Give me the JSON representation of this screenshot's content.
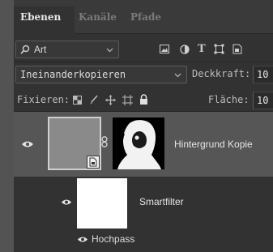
{
  "tabs": [
    {
      "label": "Ebenen",
      "active": true
    },
    {
      "label": "Kanäle",
      "active": false
    },
    {
      "label": "Pfade",
      "active": false
    }
  ],
  "filter": {
    "kind_label": "Art",
    "icons": [
      "image-filter-icon",
      "adjustment-filter-icon",
      "type-filter-icon",
      "shape-filter-icon",
      "smartobject-filter-icon"
    ]
  },
  "blend": {
    "mode": "Ineinanderkopieren",
    "opacity_label": "Deckkraft:",
    "opacity_value": "10"
  },
  "lock": {
    "label": "Fixieren:",
    "fill_label": "Fläche:",
    "fill_value": "10",
    "icons": [
      "lock-transparent-icon",
      "lock-paint-icon",
      "lock-position-icon",
      "lock-artboard-icon",
      "lock-all-icon"
    ]
  },
  "layers": [
    {
      "name": "Hintergrund Kopie",
      "selected": true,
      "visible": true
    },
    {
      "name": "Smartfilter",
      "sublayer": true,
      "visible": true
    }
  ],
  "smart_filters": [
    {
      "name": "Hochpass",
      "visible": true
    }
  ],
  "colors": {
    "panel_bg": "#323232",
    "selected_layer": "#565656",
    "outer_bg": "#535353"
  }
}
